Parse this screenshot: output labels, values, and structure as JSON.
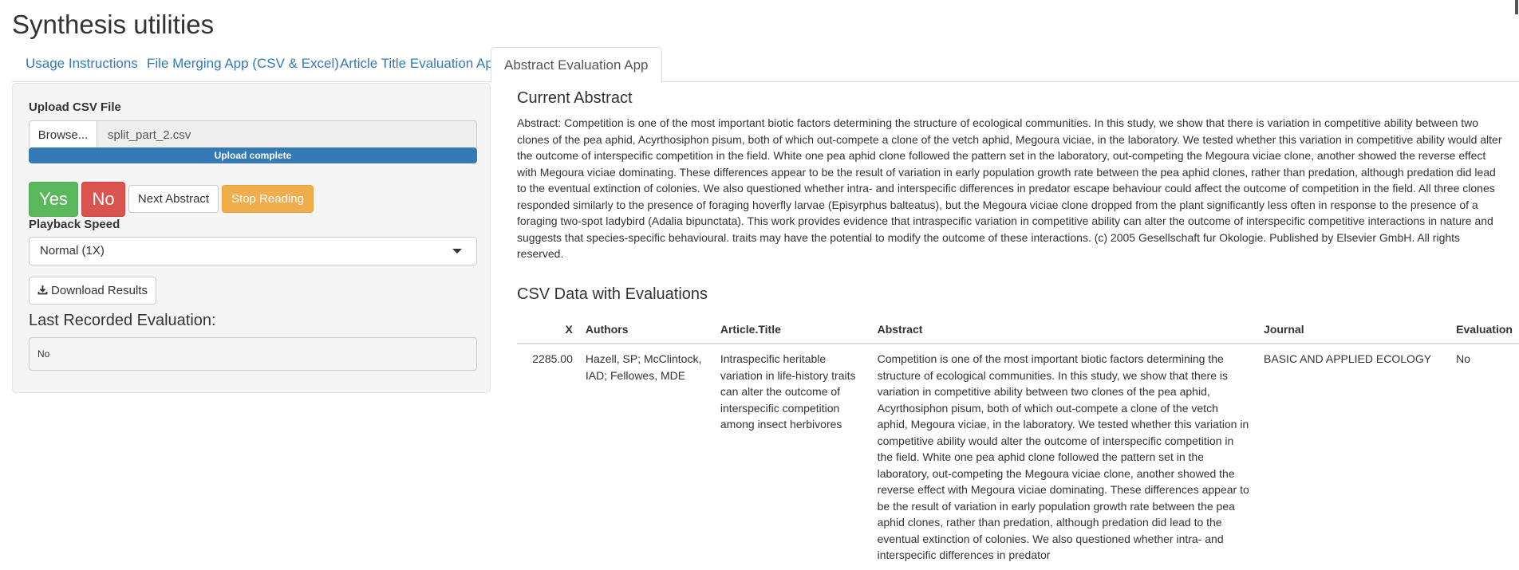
{
  "app": {
    "title": "Synthesis utilities"
  },
  "tabs": [
    {
      "label": "Usage Instructions"
    },
    {
      "label": "File Merging App (CSV & Excel)"
    },
    {
      "label": "Article Title Evaluation App"
    },
    {
      "label": "Abstract Evaluation App",
      "active": true
    }
  ],
  "sidebar": {
    "upload_label": "Upload CSV File",
    "browse_label": "Browse...",
    "file_name": "split_part_2.csv",
    "upload_status": "Upload complete",
    "yes_label": "Yes",
    "no_label": "No",
    "next_label": "Next Abstract",
    "stop_label": "Stop Reading",
    "speed_label": "Playback Speed",
    "speed_value": "Normal (1X)",
    "download_label": "Download Results",
    "last_eval_title": "Last Recorded Evaluation:",
    "last_eval_value": "No"
  },
  "main": {
    "current_abstract_title": "Current Abstract",
    "current_abstract_text": "Abstract: Competition is one of the most important biotic factors determining the structure of ecological communities. In this study, we show that there is variation in competitive ability between two clones of the pea aphid, Acyrthosiphon pisum, both of which out-compete a clone of the vetch aphid, Megoura viciae, in the laboratory. We tested whether this variation in competitive ability would alter the outcome of interspecific competition in the field. White one pea aphid clone followed the pattern set in the laboratory, out-competing the Megoura viciae clone, another showed the reverse effect with Megoura viciae dominating. These differences appear to be the result of variation in early population growth rate between the pea aphid clones, rather than predation, although predation did lead to the eventual extinction of colonies. We also questioned whether intra- and interspecific differences in predator escape behaviour could affect the outcome of competition in the field. All three clones responded similarly to the presence of foraging hoverfly larvae (Episyrphus balteatus), but the Megoura viciae clone dropped from the plant significantly less often in response to the presence of a foraging two-spot ladybird (Adalia bipunctata). This work provides evidence that intraspecific variation in competitive ability can alter the outcome of interspecific competitive interactions in nature and suggests that species-specific behavioural. traits may have the potential to modify the outcome of these interactions. (c) 2005 Gesellschaft fur Okologie. Published by Elsevier GmbH. All rights reserved.",
    "table_title": "CSV Data with Evaluations",
    "table": {
      "headers": [
        "X",
        "Authors",
        "Article.Title",
        "Abstract",
        "Journal",
        "Evaluation"
      ],
      "rows": [
        {
          "x": "2285.00",
          "authors": "Hazell, SP; McClintock, IAD; Fellowes, MDE",
          "title": "Intraspecific heritable variation in life-history traits can alter the outcome of interspecific competition among insect herbivores",
          "abstract": "Competition is one of the most important biotic factors determining the structure of ecological communities. In this study, we show that there is variation in competitive ability between two clones of the pea aphid, Acyrthosiphon pisum, both of which out-compete a clone of the vetch aphid, Megoura viciae, in the laboratory. We tested whether this variation in competitive ability would alter the outcome of interspecific competition in the field. White one pea aphid clone followed the pattern set in the laboratory, out-competing the Megoura viciae clone, another showed the reverse effect with Megoura viciae dominating. These differences appear to be the result of variation in early population growth rate between the pea aphid clones, rather than predation, although predation did lead to the eventual extinction of colonies. We also questioned whether intra- and interspecific differences in predator",
          "journal": "BASIC AND APPLIED ECOLOGY",
          "evaluation": "No"
        }
      ]
    }
  },
  "icons": {
    "download": "download-icon",
    "dropdown": "chevron-down-icon"
  },
  "colors": {
    "link": "#337ab7",
    "yes": "#5cb85c",
    "no": "#d9534f",
    "stop": "#f0ad4e",
    "progress": "#337ab7"
  }
}
